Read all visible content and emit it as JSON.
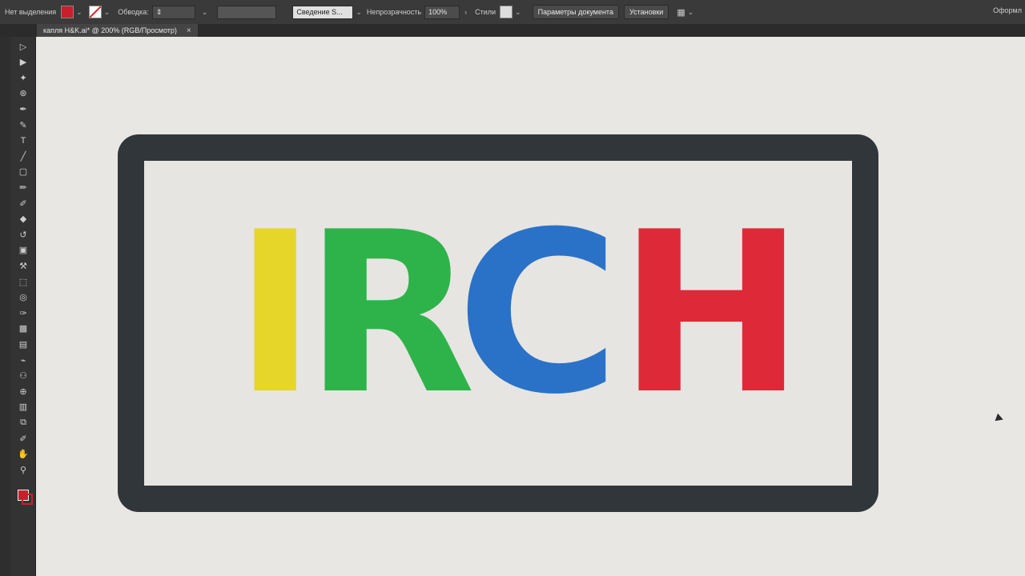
{
  "control_bar": {
    "selection_label": "Нет выделения",
    "stroke_label": "Обводка:",
    "blend_label": "Сведение S...",
    "opacity_label": "Непрозрачность",
    "opacity_value": "100%",
    "styles_label": "Стили",
    "doc_settings_label": "Параметры документа",
    "prefs_label": "Установки",
    "workspace_label": "Оформл"
  },
  "tab": {
    "title": "капля H&K.ai* @ 200% (RGB/Просмотр)",
    "close": "×"
  },
  "tools": [
    "▷",
    "▶",
    "✦",
    "⊛",
    "✒",
    "✎",
    "T",
    "╱",
    "▢",
    "✏",
    "✐",
    "◆",
    "↺",
    "▣",
    "⚒",
    "⬚",
    "◎",
    "✑",
    "▩",
    "▤",
    "⌁",
    "⚇",
    "⊕",
    "▥",
    "⧉",
    "✐",
    "✋",
    "⚲"
  ],
  "artwork": {
    "letters": [
      {
        "char": "I",
        "color": "#e6d629"
      },
      {
        "char": "R",
        "color": "#2eb34a"
      },
      {
        "char": "C",
        "color": "#2a72c8"
      },
      {
        "char": "H",
        "color": "#de2a38"
      }
    ],
    "frame_color": "#31363a"
  },
  "colors": {
    "fill": "#c8202a",
    "stroke_none": "#ffffff"
  }
}
